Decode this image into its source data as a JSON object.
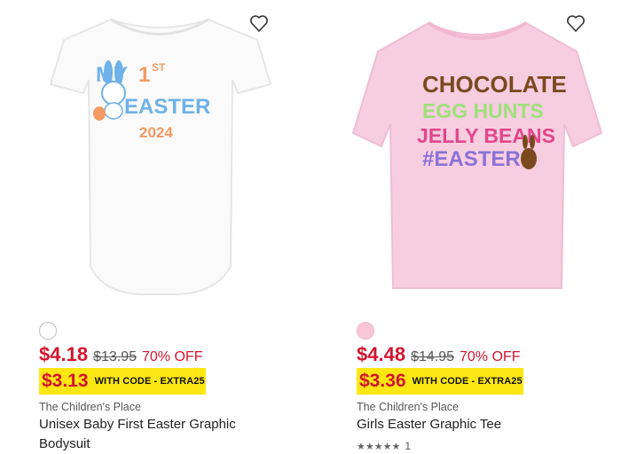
{
  "products": [
    {
      "graphic": {
        "line1a": "MY",
        "line1b": "1",
        "line1sup": "ST",
        "line2": "EASTER",
        "line3": "2024"
      },
      "swatch_color": "#ffffff",
      "sale_price": "$4.18",
      "original_price": "$13.95",
      "discount": "70% OFF",
      "code_price": "$3.13",
      "code_text": "WITH CODE - EXTRA25",
      "brand": "The Children's Place",
      "title": "Unisex Baby First Easter Graphic Bodysuit",
      "wishlist_icon": "heart-outline-icon"
    },
    {
      "graphic": {
        "line1": "CHOCOLATE",
        "line2": "EGG HUNTS",
        "line3": "JELLY BEANS",
        "line4": "#EASTER"
      },
      "swatch_color": "#f9c6d8",
      "sale_price": "$4.48",
      "original_price": "$14.95",
      "discount": "70% OFF",
      "code_price": "$3.36",
      "code_text": "WITH CODE - EXTRA25",
      "brand": "The Children's Place",
      "title": "Girls Easter Graphic Tee",
      "rating": {
        "stars": 5,
        "count": "1"
      },
      "wishlist_icon": "heart-outline-icon"
    }
  ],
  "colors": {
    "sale": "#d1152f",
    "code_bar": "#fde713",
    "tee_pink": "#f7cde0"
  }
}
